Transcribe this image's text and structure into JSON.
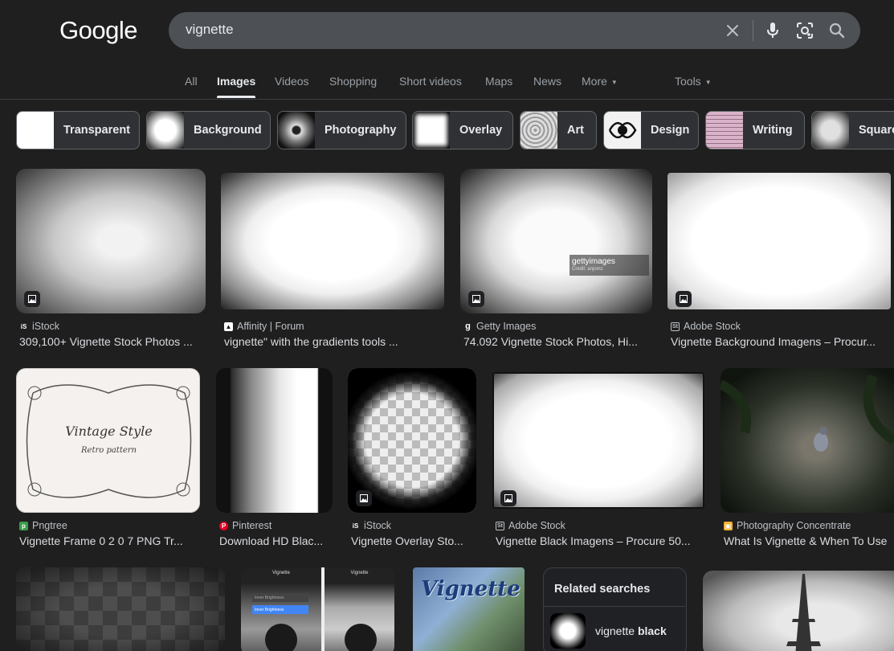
{
  "header": {
    "logo": "Google",
    "search_value": "vignette"
  },
  "nav": {
    "tabs": [
      "All",
      "Images",
      "Videos",
      "Shopping",
      "Short videos",
      "Maps",
      "News",
      "More"
    ],
    "tools": "Tools",
    "active": "Images"
  },
  "chips": [
    "Transparent",
    "Background",
    "Photography",
    "Overlay",
    "Art",
    "Design",
    "Writing",
    "Square"
  ],
  "results": [
    {
      "source": "iStock",
      "title": "309,100+ Vignette Stock Photos ..."
    },
    {
      "source": "Affinity | Forum",
      "title": "vignette\" with the gradients tools ..."
    },
    {
      "source": "Getty Images",
      "title": "74.092 Vignette Stock Photos, Hi..."
    },
    {
      "source": "Adobe Stock",
      "title": "Vignette Background Imagens – Procur..."
    },
    {
      "source": "Pngtree",
      "title": "Vignette Frame 0 2 0 7 PNG Tr..."
    },
    {
      "source": "Pinterest",
      "title": "Download HD Blac..."
    },
    {
      "source": "iStock",
      "title": "Vignette Overlay Sto..."
    },
    {
      "source": "Adobe Stock",
      "title": "Vignette Black Imagens – Procure 50..."
    },
    {
      "source": "Photography Concentrate",
      "title": "What Is Vignette & When To Use"
    }
  ],
  "image_texts": {
    "getty_watermark": "gettyimages",
    "getty_credit": "Credit: anjomz",
    "vintage_title": "Vintage Style",
    "vintage_sub": "Retro pattern",
    "vignette_poster": "Vignette",
    "app_title": "Vignette",
    "app_menu_1": "Inner Brightness",
    "app_menu_2": "Inner Brightness"
  },
  "related": {
    "title": "Related searches",
    "item_prefix": "vignette ",
    "item_bold": "black"
  },
  "colors": {
    "background": "#1f1f1f",
    "search_box": "#4d5156",
    "chip_bg": "#303134",
    "accent_blue": "#4285f4"
  }
}
